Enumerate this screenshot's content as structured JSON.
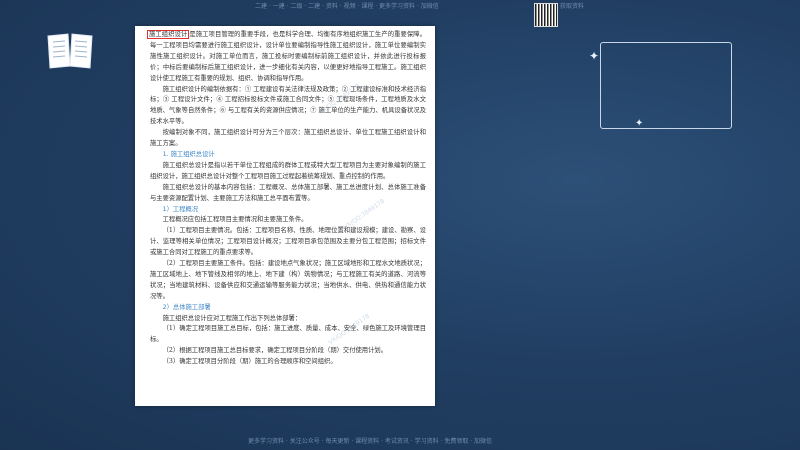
{
  "header": {
    "strip_text": "二建 · 一建 · 二级 · 二建 · 资料 · 视频 · 课程 · 更多学习资料 · 加微信",
    "right_strip_text": "获取资料"
  },
  "footer": {
    "strip_text": "更多学习资料 · 关注公众号 · 每天更新 · 课程资料 · 考试资讯 · 学习资料 · 免费领取 · 加微信"
  },
  "icons": {
    "book": "open-book-icon",
    "qr": "qr-code-icon",
    "sparkle": "sparkle-icon"
  },
  "colors": {
    "background": "#1f3a5c",
    "highlight_box": "#e0312f",
    "heading_blue": "#3d86c6"
  },
  "document": {
    "highlight_term": "施工组织设计",
    "paragraphs": [
      "是施工项目管理的重要手段，也是科学合理、均衡有序地组织施工生产的重要保障。每一工程项目均需要进行施工组织设计，设计单位要编制指导性施工组织设计，施工单位要编制实施性施工组织设计。对施工单位而言，施工投标时要编制标前施工组织设计，并依此进行投标报价；中标后要编制标后施工组织设计，进一步细化有关内容，以便更好地指导工程施工。施工组织设计使工程施工有重要的规划、组织、协调和指导作用。",
      "施工组织设计的编制依据有：① 工程建设有关法律法规及政策；② 工程建设标准和技术经济指标；③ 工程设计文件；④ 工程招标投标文件或施工合同文件；⑤ 工程现场条件，工程地质及水文地质、气象等自然条件；⑥ 与工程有关的资源供应情况；⑦ 施工单位的生产能力、机具设备状况及技术水平等。",
      "按编制对象不同，施工组织设计可分为三个层次：施工组织总设计、单位工程施工组织设计和施工方案。"
    ],
    "section1": {
      "heading": "1. 施工组织总设计",
      "paragraphs": [
        "施工组织总设计是指以若干单位工程组成的群体工程或特大型工程项目为主要对象编制的施工组织设计，施工组织总设计对整个工程项目施工过程起着统筹规划、重点控制的作用。",
        "施工组织总设计的基本内容包括：工程概况、总体施工部署、施工总进度计划、总体施工准备与主要资源配置计划、主要施工方法和施工总平面布置等。"
      ],
      "sub1": {
        "heading": "1）工程概况",
        "paragraphs": [
          "工程概况应包括工程项目主要情况和主要施工条件。",
          "（1）工程项目主要情况。包括：工程项目名称、性质、地理位置和建设规模；建设、勘察、设计、监理等相关单位情况；工程项目设计概况；工程项目承包范围及主要分包工程范围；招标文件或施工合同对工程施工的重点要求等。",
          "（2）工程项目主要施工条件。包括：建设地点气象状况；施工区域地形和工程水文地质状况；施工区域地上、地下管线及相邻的地上、地下建（构）筑物情况；与工程施工有关的道路、河流等状况；当地建筑材料、设备供应和交通运输等服务能力状况；当地供水、供电、供热和通信能力状况等。"
        ]
      },
      "sub2": {
        "heading": "2）总体施工部署",
        "paragraphs": [
          "施工组织总设计应对工程施工作出下列总体部署：",
          "（1）确定工程项目施工总目标，包括：施工进度、质量、成本、安全、绿色施工及环境管理目标。",
          "（2）根据工程项目施工总目标要求，确定工程项目分阶段（期）交付使用计划。",
          "（3）确定工程项目分阶段（期）施工的合理顺序和空间组织。"
        ]
      }
    },
    "watermarks": [
      "VX/QQ:3849178",
      "VX/QQ:3849178",
      "VX/QQ:3849178"
    ]
  }
}
